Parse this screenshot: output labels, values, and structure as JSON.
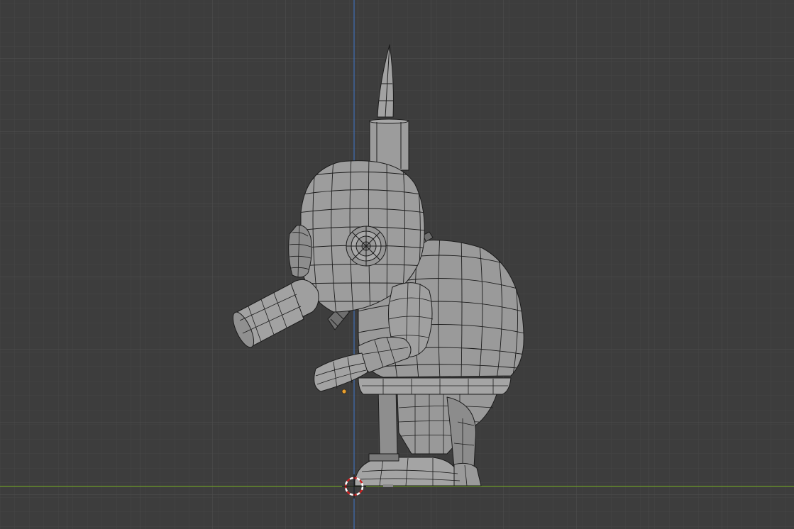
{
  "viewport": {
    "view": "side-orthographic",
    "shading": "solid-with-wireframe-overlay",
    "background_color": "#3d3d3d",
    "grid_minor_color": "#454545",
    "grid_major_color": "#505050",
    "x_axis_color": "#6c9a2a",
    "z_axis_color": "#3f6fb4"
  },
  "scene": {
    "object": "gas-mask-character-model",
    "mesh_fill": "#9a9a9a",
    "mesh_wire": "#1c1c1c",
    "origin_color": "#e8a030",
    "cursor_colors": [
      "#cc2222",
      "#ffffff"
    ]
  }
}
